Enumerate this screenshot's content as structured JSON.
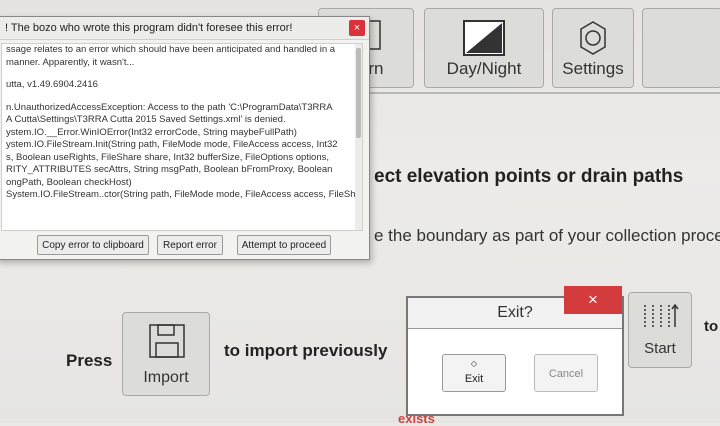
{
  "toolbar": {
    "scrn_label": "Scrn",
    "daynight_label": "Day/Night",
    "settings_label": "Settings"
  },
  "main": {
    "instruction_1": "ect elevation points or drain paths",
    "instruction_2": "e the boundary as part of your collection process",
    "press_label": "Press",
    "import_label": "Import",
    "import_text": "to import previously",
    "start_label": "Start",
    "to_label": "to",
    "bottom_partial": "exists"
  },
  "error_dialog": {
    "title": "! The bozo who wrote this program didn't foresee this error!",
    "close": "×",
    "lines": [
      "ssage relates to an error which should have been anticipated and handled in a",
      "manner. Apparently, it wasn't...",
      "",
      "utta, v1.49.6904.2416",
      "",
      "n.UnauthorizedAccessException: Access to the path 'C:\\ProgramData\\T3RRA",
      "A Cutta\\Settings\\T3RRA Cutta 2015 Saved Settings.xml' is denied.",
      "ystem.IO.__Error.WinIOError(Int32 errorCode, String maybeFullPath)",
      "ystem.IO.FileStream.Init(String path, FileMode mode, FileAccess access, Int32",
      "s, Boolean useRights, FileShare share, Int32 bufferSize, FileOptions options,",
      "RITY_ATTRIBUTES secAttrs, String msgPath, Boolean bFromProxy, Boolean",
      "ongPath, Boolean checkHost)",
      " System.IO.FileStream..ctor(String path, FileMode mode, FileAccess access, FileShare"
    ],
    "buttons": {
      "copy": "Copy error to clipboard",
      "report": "Report error",
      "proceed": "Attempt to proceed"
    }
  },
  "exit_dialog": {
    "title": "Exit?",
    "close": "×",
    "exit_label": "Exit",
    "cancel_label": "Cancel"
  }
}
